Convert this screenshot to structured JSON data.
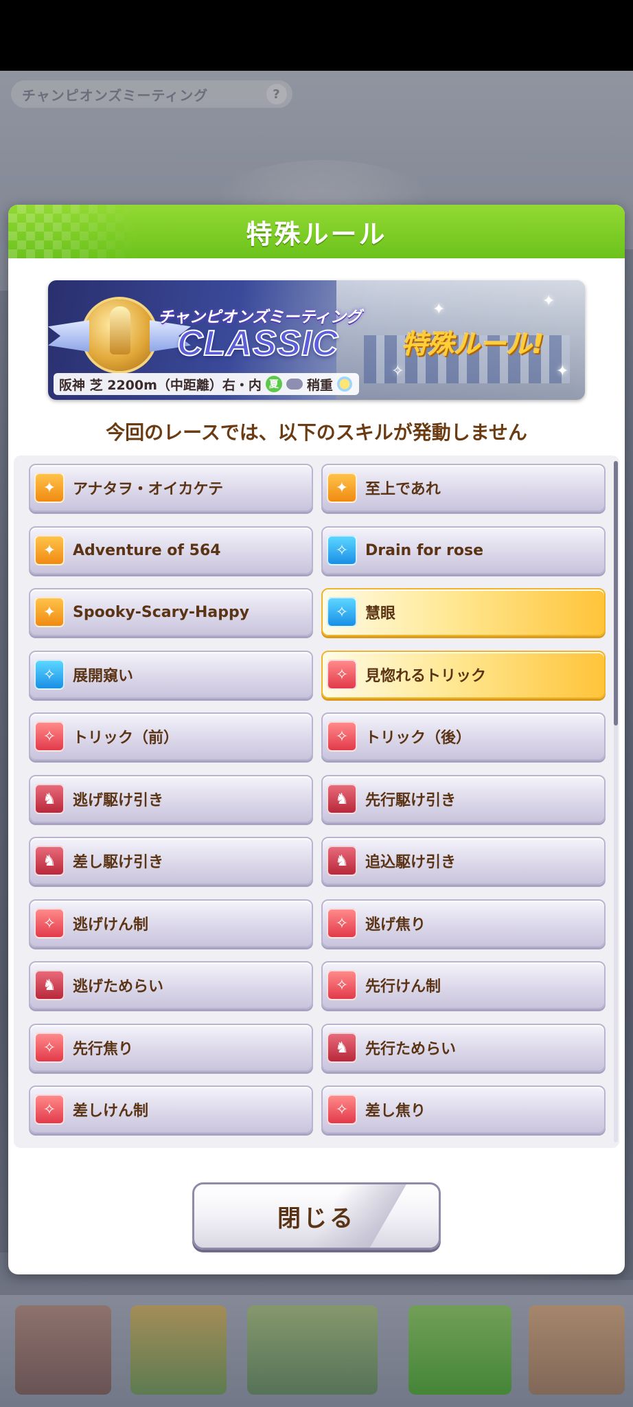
{
  "scene": {
    "title": "チャンピオンズミーティング",
    "help_glyph": "?"
  },
  "dialog": {
    "title": "特殊ルール",
    "banner": {
      "subtitle": "チャンピオンズミーティング",
      "main_title": "CLASSIC",
      "rule_label": "特殊ルール!",
      "course_info": "阪神 芝 2200m（中距離）右・内",
      "season_badge": "夏",
      "track_condition": "稍重"
    },
    "notice": "今回のレースでは、以下のスキルが発動しません",
    "skills": [
      {
        "name": "アナタヲ・オイカケテ",
        "icon": "unique-skill-icon",
        "color": "orange",
        "glyph": "✦",
        "highlight": false
      },
      {
        "name": "至上であれ",
        "icon": "unique-skill-icon",
        "color": "orange",
        "glyph": "✦",
        "highlight": false
      },
      {
        "name": "Adventure of 564",
        "icon": "unique-skill-icon",
        "color": "orange",
        "glyph": "✦",
        "highlight": false
      },
      {
        "name": "Drain for rose",
        "icon": "recovery-skill-icon",
        "color": "blue",
        "glyph": "✧",
        "highlight": false
      },
      {
        "name": "Spooky-Scary-Happy",
        "icon": "unique-skill-icon",
        "color": "orange",
        "glyph": "✦",
        "highlight": false
      },
      {
        "name": "慧眼",
        "icon": "recovery-skill-icon",
        "color": "blue",
        "glyph": "✧",
        "highlight": true
      },
      {
        "name": "展開窺い",
        "icon": "recovery-skill-icon",
        "color": "blue",
        "glyph": "✧",
        "highlight": false
      },
      {
        "name": "見惚れるトリック",
        "icon": "debuff-skill-icon",
        "color": "red",
        "glyph": "✧",
        "highlight": true
      },
      {
        "name": "トリック（前）",
        "icon": "debuff-skill-icon",
        "color": "red",
        "glyph": "✧",
        "highlight": false
      },
      {
        "name": "トリック（後）",
        "icon": "debuff-skill-icon",
        "color": "red",
        "glyph": "✧",
        "highlight": false
      },
      {
        "name": "逃げ駆け引き",
        "icon": "horse-debuff-icon",
        "color": "darkred",
        "glyph": "♞",
        "highlight": false
      },
      {
        "name": "先行駆け引き",
        "icon": "horse-debuff-icon",
        "color": "darkred",
        "glyph": "♞",
        "highlight": false
      },
      {
        "name": "差し駆け引き",
        "icon": "horse-debuff-icon",
        "color": "darkred",
        "glyph": "♞",
        "highlight": false
      },
      {
        "name": "追込駆け引き",
        "icon": "horse-debuff-icon",
        "color": "darkred",
        "glyph": "♞",
        "highlight": false
      },
      {
        "name": "逃げけん制",
        "icon": "debuff-skill-icon",
        "color": "red",
        "glyph": "✧",
        "highlight": false
      },
      {
        "name": "逃げ焦り",
        "icon": "debuff-skill-icon",
        "color": "red",
        "glyph": "✧",
        "highlight": false
      },
      {
        "name": "逃げためらい",
        "icon": "horse-debuff-icon",
        "color": "darkred",
        "glyph": "♞",
        "highlight": false
      },
      {
        "name": "先行けん制",
        "icon": "debuff-skill-icon",
        "color": "red",
        "glyph": "✧",
        "highlight": false
      },
      {
        "name": "先行焦り",
        "icon": "debuff-skill-icon",
        "color": "red",
        "glyph": "✧",
        "highlight": false
      },
      {
        "name": "先行ためらい",
        "icon": "horse-debuff-icon",
        "color": "darkred",
        "glyph": "♞",
        "highlight": false
      },
      {
        "name": "差しけん制",
        "icon": "debuff-skill-icon",
        "color": "red",
        "glyph": "✧",
        "highlight": false
      },
      {
        "name": "差し焦り",
        "icon": "debuff-skill-icon",
        "color": "red",
        "glyph": "✧",
        "highlight": false
      }
    ],
    "close_label": "閉じる"
  }
}
